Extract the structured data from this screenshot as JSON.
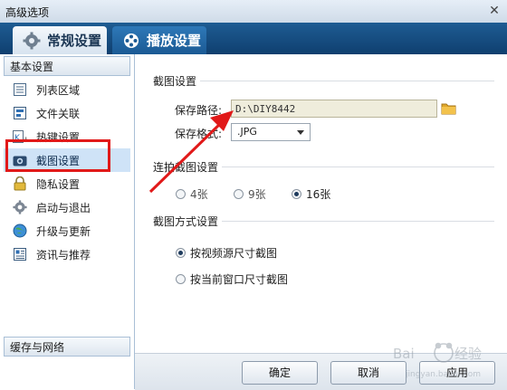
{
  "window": {
    "title": "高级选项",
    "close_glyph": "✕"
  },
  "tabs": [
    {
      "label": "常规设置",
      "icon": "gear-icon",
      "active": true
    },
    {
      "label": "播放设置",
      "icon": "film-reel-icon",
      "active": false
    }
  ],
  "sidebar": {
    "header": "基本设置",
    "items": [
      {
        "label": "列表区域",
        "icon": "list-icon"
      },
      {
        "label": "文件关联",
        "icon": "file-association-icon"
      },
      {
        "label": "热键设置",
        "icon": "hotkey-icon"
      },
      {
        "label": "截图设置",
        "icon": "camera-icon",
        "selected": true
      },
      {
        "label": "隐私设置",
        "icon": "lock-icon"
      },
      {
        "label": "启动与退出",
        "icon": "gear-icon"
      },
      {
        "label": "升级与更新",
        "icon": "globe-icon"
      },
      {
        "label": "资讯与推荐",
        "icon": "news-icon"
      }
    ],
    "footer": "缓存与网络"
  },
  "screenshot_settings": {
    "section_title": "截图设置",
    "path_label": "保存路径:",
    "path_value": "D:\\DIY8442",
    "format_label": "保存格式:",
    "format_value": ".JPG"
  },
  "burst_settings": {
    "section_title": "连拍截图设置",
    "options": [
      {
        "label": "4张",
        "checked": false
      },
      {
        "label": "9张",
        "checked": false
      },
      {
        "label": "16张",
        "checked": true
      }
    ]
  },
  "capture_mode": {
    "section_title": "截图方式设置",
    "options": [
      {
        "label": "按视频源尺寸截图",
        "checked": true
      },
      {
        "label": "按当前窗口尺寸截图",
        "checked": false
      }
    ]
  },
  "buttons": {
    "ok": "确定",
    "cancel": "取消",
    "apply": "应用"
  },
  "annotation_color": "#e11919",
  "watermark": "Baidu 经验"
}
